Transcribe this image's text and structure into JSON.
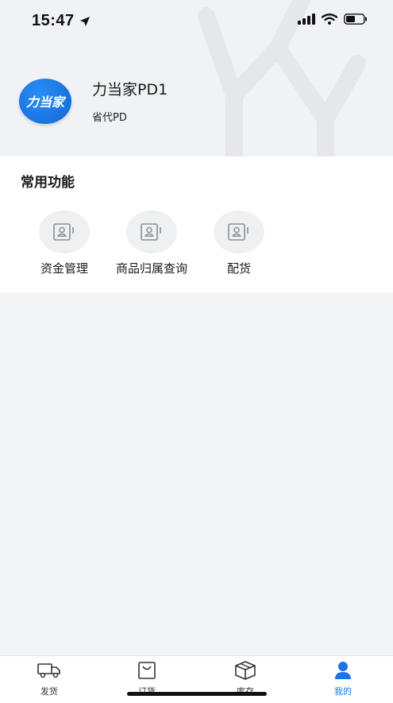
{
  "status_bar": {
    "time": "15:47"
  },
  "profile": {
    "avatar_text": "力当家",
    "name": "力当家PD1",
    "role": "省代PD"
  },
  "functions": {
    "title": "常用功能",
    "items": [
      {
        "label": "资金管理",
        "icon": "contact-card-icon"
      },
      {
        "label": "商品归属查询",
        "icon": "contact-card-icon"
      },
      {
        "label": "配货",
        "icon": "contact-card-icon"
      }
    ]
  },
  "tabbar": {
    "items": [
      {
        "label": "发货",
        "icon": "truck-icon"
      },
      {
        "label": "订货",
        "icon": "bag-icon"
      },
      {
        "label": "库存",
        "icon": "box-icon"
      },
      {
        "label": "我的",
        "icon": "user-icon"
      }
    ],
    "active": "我的",
    "active_color": "#1a73e8"
  }
}
